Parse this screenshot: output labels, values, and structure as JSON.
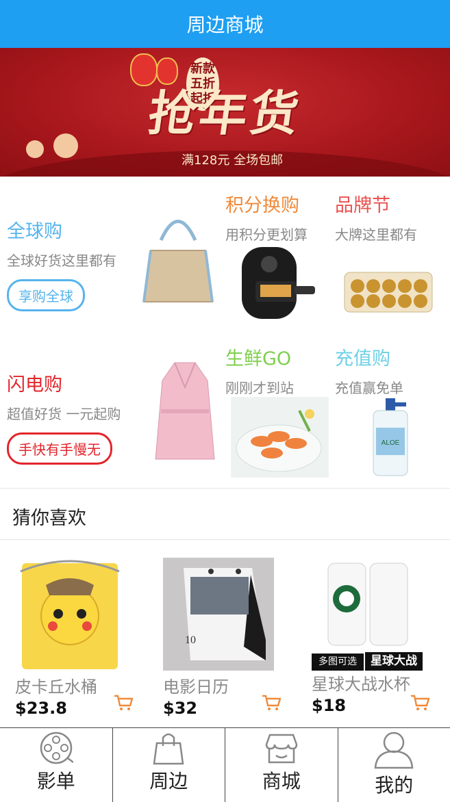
{
  "header": {
    "title": "周边商城"
  },
  "banner": {
    "tag": "新款五折起折",
    "headline": "抢年货",
    "subline": "满128元 全场包邮"
  },
  "features": [
    {
      "title": "全球购",
      "desc": "全球好货这里都有",
      "button": "享购全球",
      "color": "#56b3ec"
    },
    {
      "title": "积分换购",
      "desc": "用积分更划算",
      "color": "#f08a3a"
    },
    {
      "title": "品牌节",
      "desc": "大牌这里都有",
      "color": "#e9534f"
    },
    {
      "title": "闪电购",
      "desc": "超值好货 一元起购",
      "button": "手快有手慢无",
      "color": "#e2252b"
    },
    {
      "title": "生鲜GO",
      "desc": "刚刚才到站",
      "color": "#7fcf4e"
    },
    {
      "title": "充值购",
      "desc": "充值赢免单",
      "color": "#6ed0e6"
    }
  ],
  "guess": {
    "title": "猜你喜欢"
  },
  "products": [
    {
      "name": "皮卡丘水桶",
      "price": "$23.8"
    },
    {
      "name": "电影日历",
      "price": "$32"
    },
    {
      "name": "星球大战水杯",
      "price": "$18",
      "badge1": "多图可选",
      "badge2": "星球大战"
    }
  ],
  "tabs": [
    {
      "label": "影单",
      "icon": "film-reel-icon"
    },
    {
      "label": "周边",
      "icon": "shopping-bag-icon"
    },
    {
      "label": "商城",
      "icon": "store-icon"
    },
    {
      "label": "我的",
      "icon": "user-icon"
    }
  ],
  "colors": {
    "header": "#1e9ff2",
    "cart": "#f08a3a"
  }
}
